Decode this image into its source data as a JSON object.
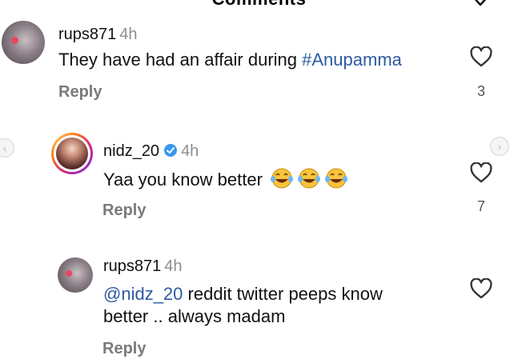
{
  "header": {
    "title": "Comments"
  },
  "comments": [
    {
      "username": "rups871",
      "time": "4h",
      "text_before": "They have had an affair during ",
      "hashtag": "#Anupamma",
      "reply_label": "Reply",
      "likes": "3"
    },
    {
      "username": "nidz_20",
      "time": "4h",
      "text": "Yaa you know better ",
      "reply_label": "Reply",
      "likes": "7"
    },
    {
      "username": "rups871",
      "time": "4h",
      "mention": "@nidz_20",
      "line1_rest": " reddit twitter peeps know",
      "line2": "better .. always madam",
      "reply_label": "Reply"
    }
  ],
  "icons": {
    "heart": "heart-icon",
    "verified": "verified-badge-icon",
    "emoji": "laughing-with-tears-emoji",
    "prev": "chevron-left-icon",
    "next": "chevron-right-icon"
  },
  "colors": {
    "link": "#2c5aa0",
    "verified": "#3897f0",
    "muted": "#8e8e8e"
  }
}
